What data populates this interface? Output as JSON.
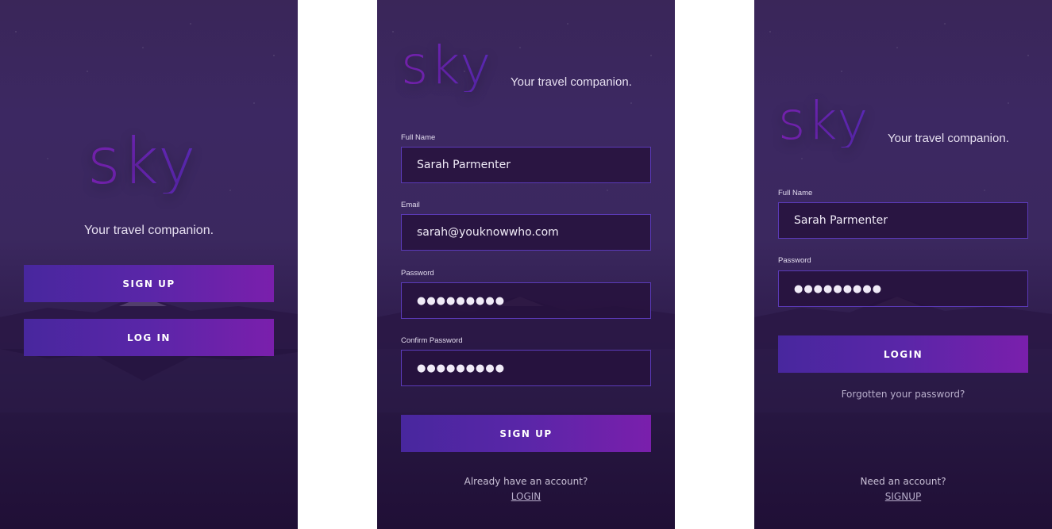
{
  "colors": {
    "background": "#3b285f",
    "accent_start": "#48279e",
    "accent_end": "#7a1fac",
    "field_border": "#5b3ab8",
    "logo": "#6a23b0"
  },
  "welcome": {
    "logo": "sky",
    "tagline": "Your travel companion.",
    "signup_button": "SIGN UP",
    "login_button": "LOG IN"
  },
  "signup": {
    "logo": "sky",
    "tagline": "Your travel companion.",
    "full_name_label": "Full Name",
    "full_name_value": "Sarah Parmenter",
    "email_label": "Email",
    "email_value": "sarah@youknowwho.com",
    "password_label": "Password",
    "password_value": "●●●●●●●●●",
    "confirm_label": "Confirm Password",
    "confirm_value": "●●●●●●●●●",
    "submit_button": "SIGN UP",
    "footer_text": "Already have an account?",
    "footer_link": "LOGIN"
  },
  "login": {
    "logo": "sky",
    "tagline": "Your travel companion.",
    "full_name_label": "Full Name",
    "full_name_value": "Sarah Parmenter",
    "password_label": "Password",
    "password_value": "●●●●●●●●●",
    "submit_button": "LOGIN",
    "forgot_link": "Forgotten your password?",
    "footer_text": "Need an account?",
    "footer_link": "SIGNUP"
  }
}
